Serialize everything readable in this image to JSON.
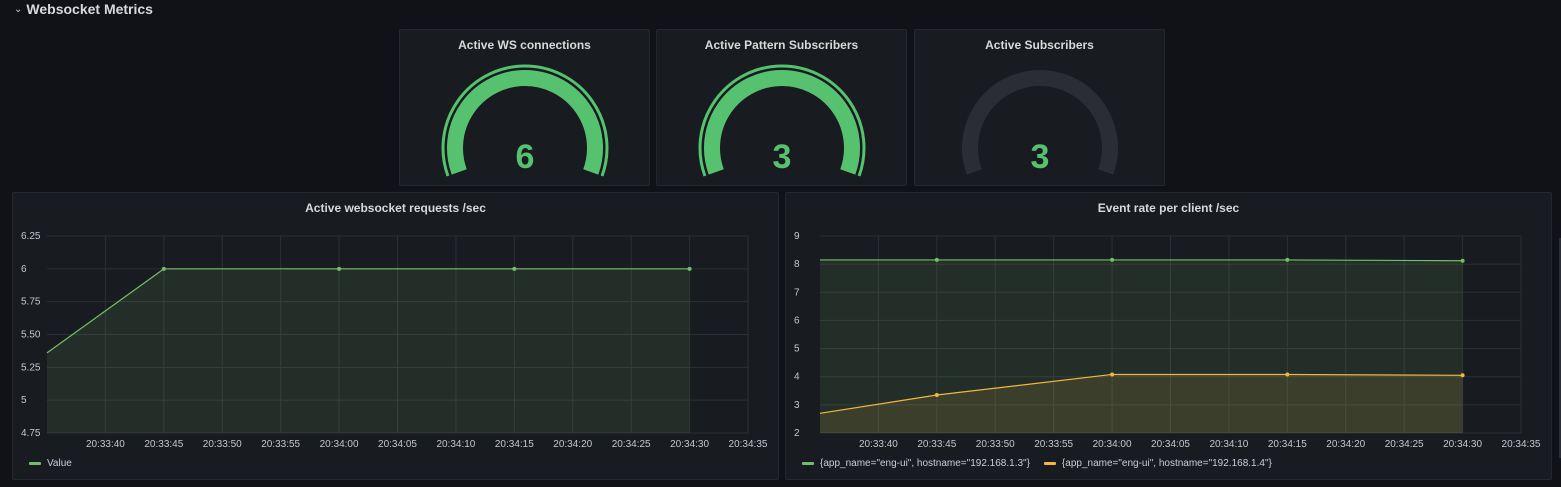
{
  "row": {
    "chevron": "⌄",
    "title": "Websocket Metrics"
  },
  "colors": {
    "green": "#73bf69",
    "gauge_green": "#56c26f",
    "yellow": "#f2b73f",
    "track": "#2a2d33"
  },
  "gauges": [
    {
      "title": "Active WS connections",
      "value": "6",
      "level": 1.0
    },
    {
      "title": "Active Pattern Subscribers",
      "value": "3",
      "level": 1.0
    },
    {
      "title": "Active Subscribers",
      "value": "3",
      "level": 0.0
    }
  ],
  "chart_data": [
    {
      "type": "line",
      "title": "Active websocket requests /sec",
      "x_ticks": [
        "20:33:40",
        "20:33:45",
        "20:33:50",
        "20:33:55",
        "20:34:00",
        "20:34:05",
        "20:34:10",
        "20:34:15",
        "20:34:20",
        "20:34:25",
        "20:34:30",
        "20:34:35"
      ],
      "y_ticks": [
        "4.75",
        "5",
        "5.25",
        "5.50",
        "5.75",
        "6",
        "6.25"
      ],
      "ylim": [
        4.75,
        6.25
      ],
      "xlim": [
        "20:33:35",
        "20:34:35"
      ],
      "grid": true,
      "legend_position": "bottom-left",
      "series": [
        {
          "name": "Value",
          "color": "#73bf69",
          "x": [
            "20:33:35",
            "20:33:45",
            "20:34:00",
            "20:34:15",
            "20:34:30"
          ],
          "values": [
            5.36,
            6,
            6,
            6,
            6
          ]
        }
      ]
    },
    {
      "type": "line",
      "title": "Event rate per client /sec",
      "x_ticks": [
        "20:33:40",
        "20:33:45",
        "20:33:50",
        "20:33:55",
        "20:34:00",
        "20:34:05",
        "20:34:10",
        "20:34:15",
        "20:34:20",
        "20:34:25",
        "20:34:30",
        "20:34:35"
      ],
      "y_ticks": [
        "2",
        "3",
        "4",
        "5",
        "6",
        "7",
        "8",
        "9"
      ],
      "ylim": [
        2,
        9
      ],
      "xlim": [
        "20:33:35",
        "20:34:35"
      ],
      "grid": true,
      "legend_position": "bottom-left",
      "series": [
        {
          "name": "{app_name=\"eng-ui\", hostname=\"192.168.1.3\"}",
          "color": "#73bf69",
          "x": [
            "20:33:35",
            "20:33:45",
            "20:34:00",
            "20:34:15",
            "20:34:30"
          ],
          "values": [
            8.15,
            8.15,
            8.15,
            8.15,
            8.12
          ]
        },
        {
          "name": "{app_name=\"eng-ui\", hostname=\"192.168.1.4\"}",
          "color": "#f2b73f",
          "x": [
            "20:33:35",
            "20:33:45",
            "20:34:00",
            "20:34:15",
            "20:34:30"
          ],
          "values": [
            2.7,
            3.35,
            4.08,
            4.08,
            4.05
          ]
        }
      ]
    }
  ]
}
